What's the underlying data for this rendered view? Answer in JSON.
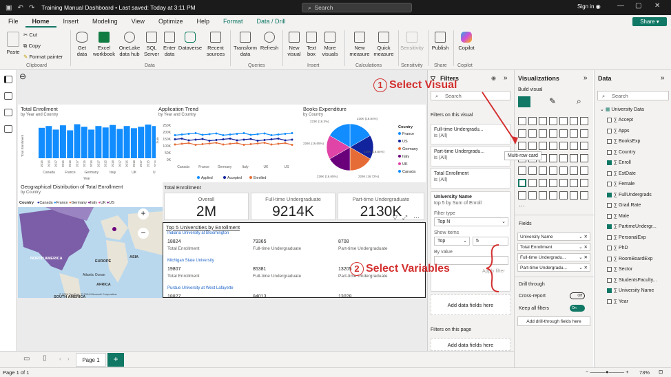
{
  "app": {
    "title": "Training Manual Dashboard • Last saved: Today at 3:11 PM",
    "search": "Search",
    "signin": "Sign in",
    "share": "Share"
  },
  "tabs": [
    "File",
    "Home",
    "Insert",
    "Modeling",
    "View",
    "Optimize",
    "Help",
    "Format",
    "Data / Drill"
  ],
  "ribbon": {
    "clipboard": {
      "paste": "Paste",
      "cut": "Cut",
      "copy": "Copy",
      "format_painter": "Format painter",
      "group": "Clipboard"
    },
    "data": {
      "get_data": "Get data",
      "excel": "Excel workbook",
      "onelake": "OneLake data hub",
      "sql": "SQL Server",
      "enter": "Enter data",
      "dataverse": "Dataverse",
      "recent": "Recent sources",
      "group": "Data"
    },
    "queries": {
      "transform": "Transform data",
      "refresh": "Refresh",
      "group": "Queries"
    },
    "insert": {
      "new_visual": "New visual",
      "text_box": "Text box",
      "more": "More visuals",
      "group": "Insert"
    },
    "calculations": {
      "new_measure": "New measure",
      "quick": "Quick measure",
      "group": "Calculations"
    },
    "sensitivity": {
      "label": "Sensitivity",
      "group": "Sensitivity"
    },
    "share": {
      "publish": "Publish",
      "group": "Share"
    },
    "copilot": {
      "label": "Copilot",
      "group": "Copilot"
    }
  },
  "report": {
    "enrollment": {
      "title": "Total Enrollment",
      "subtitle": "by Year and Country",
      "ylabel": "Total Enrollment",
      "xlabel": "Year",
      "countries": [
        "Canada",
        "France",
        "Germany",
        "Italy",
        "UK",
        "US"
      ],
      "years": [
        "2015",
        "2016",
        "2017"
      ]
    },
    "trend": {
      "title": "Application Trend",
      "subtitle": "by Year and Country",
      "ylabel": "Sum",
      "ticks": [
        "250K",
        "200K",
        "150K",
        "100K",
        "50K",
        "0K"
      ],
      "countries": [
        "Canada",
        "France",
        "Germany",
        "Italy",
        "UK",
        "US"
      ],
      "legend": [
        "Applied",
        "Accepted",
        "Enrolled"
      ]
    },
    "books": {
      "title": "Books Expenditure",
      "subtitle": "by Country",
      "legend_title": "Country",
      "legend": [
        "France",
        "US",
        "Germany",
        "Italy",
        "UK",
        "Canada"
      ],
      "labels": [
        "223K (16.3%)",
        "230K (16.84%)",
        "226K (16.65%)",
        "230K (16.84%)",
        "226K (16.65%)",
        "229K (16.72%)"
      ]
    },
    "geo": {
      "title": "Geographical Distribution of Total Enrollment",
      "subtitle": "by Country",
      "legend_title": "Country",
      "legend": [
        "Canada",
        "France",
        "Germany",
        "Italy",
        "UK",
        "US"
      ],
      "labels": [
        "NORTH AMERICA",
        "EUROPE",
        "ASIA",
        "AFRICA",
        "Atlantic Ocean",
        "SOUTH AMERICA"
      ],
      "attribution": "© 2024 TomTom, © 2024 Microsoft Corporation"
    },
    "cards": {
      "title": "Total Enrollment",
      "items": [
        {
          "label": "Overall",
          "value": "2M"
        },
        {
          "label": "Full-time Undergraduate",
          "value": "9214K"
        },
        {
          "label": "Part-time Undergraduate",
          "value": "2130K"
        }
      ]
    },
    "top5": {
      "title": "Top 5 Universities by Enrollment",
      "rows": [
        {
          "name": "Indiana University at Bloomington",
          "v1": "18824",
          "v2": "79365",
          "v3": "8708"
        },
        {
          "name": "Michigan State University",
          "v1": "19807",
          "v2": "85381",
          "v3": "13205"
        },
        {
          "name": "Purdue University at West Lafayette",
          "v1": "18827",
          "v2": "84013",
          "v3": "13028"
        }
      ],
      "labels": [
        "Total Enrollment",
        "Full-time Undergraduate",
        "Part-time Undergraduate"
      ]
    }
  },
  "filters": {
    "title": "Filters",
    "search": "Search",
    "on_visual": "Filters on this visual",
    "items": [
      {
        "name": "Full-time Undergradu...",
        "value": "is (All)"
      },
      {
        "name": "Part-time Undergradu...",
        "value": "is (All)"
      },
      {
        "name": "Total Enrollment",
        "value": "is (All)"
      }
    ],
    "active": {
      "name": "University Name",
      "desc": "top 5 by Sum of Enroll",
      "type_label": "Filter type",
      "type": "Top N",
      "show_label": "Show items",
      "show_dir": "Top",
      "show_n": "5",
      "by_label": "By value",
      "apply": "Apply filter"
    },
    "add": "Add data fields here",
    "on_page": "Filters on this page",
    "add2": "Add data fields here"
  },
  "viz": {
    "title": "Visualizations",
    "build": "Build visual",
    "tooltip": "Multi-row card",
    "fields_label": "Fields",
    "fields": [
      "University Name",
      "Total Enrollment",
      "Full-time Undergradu...",
      "Part-time Undergradu..."
    ],
    "drill": "Drill through",
    "cross": "Cross-report",
    "cross_state": "Off",
    "keep": "Keep all filters",
    "keep_state": "On",
    "add_drill": "Add drill-through fields here"
  },
  "data": {
    "title": "Data",
    "search": "Search",
    "table": "University Data",
    "fields": [
      {
        "n": "Accept",
        "c": false
      },
      {
        "n": "Apps",
        "c": false
      },
      {
        "n": "BooksExp",
        "c": false
      },
      {
        "n": "Country",
        "c": false
      },
      {
        "n": "Enroll",
        "c": true
      },
      {
        "n": "EstDate",
        "c": false
      },
      {
        "n": "Female",
        "c": false
      },
      {
        "n": "FullUndergrads",
        "c": true
      },
      {
        "n": "Grad.Rate",
        "c": false
      },
      {
        "n": "Male",
        "c": false
      },
      {
        "n": "PartimeUndergr...",
        "c": true
      },
      {
        "n": "PersonalExp",
        "c": false
      },
      {
        "n": "PhD",
        "c": false
      },
      {
        "n": "RoomBoardExp",
        "c": false
      },
      {
        "n": "Sector",
        "c": false
      },
      {
        "n": "StudentsFaculty...",
        "c": false
      },
      {
        "n": "University Name",
        "c": true
      },
      {
        "n": "Year",
        "c": false
      }
    ]
  },
  "annotations": {
    "one": "1",
    "one_text": "Select Visual",
    "two": "2",
    "two_text": "Select Variables"
  },
  "pages": {
    "page1": "Page 1",
    "add": "+"
  },
  "status": {
    "page": "Page 1 of 1",
    "zoom": "73%"
  },
  "colors": {
    "accent": "#117865",
    "blue": "#118dff",
    "navy": "#12239e",
    "orange": "#e66c37",
    "purple": "#6b007b",
    "magenta": "#e044a7",
    "red": "#d32f2f"
  }
}
